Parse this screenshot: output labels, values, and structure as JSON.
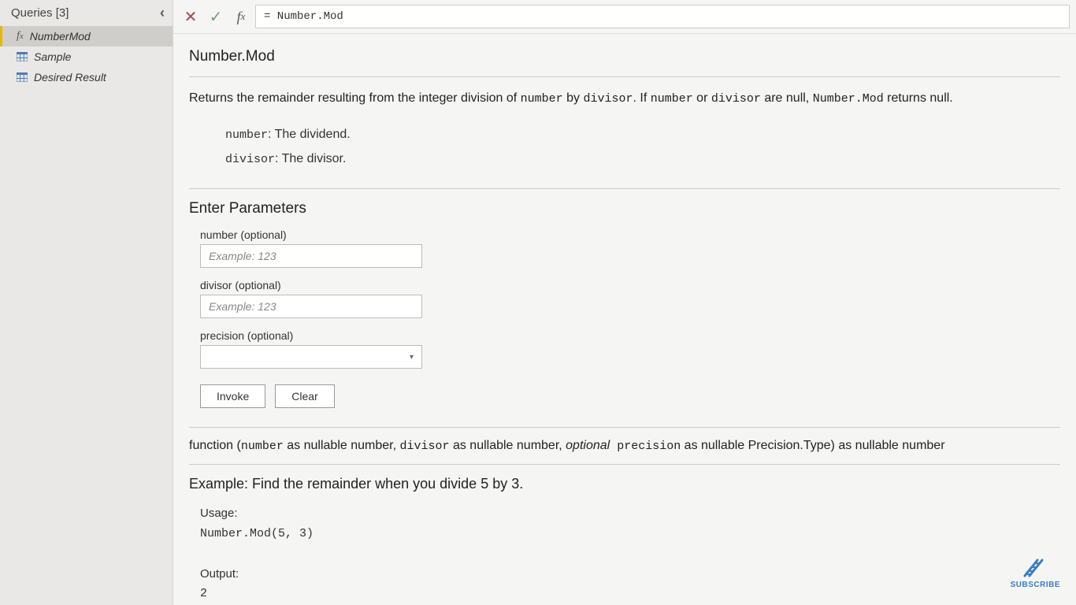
{
  "sidebar": {
    "title": "Queries [3]",
    "items": [
      {
        "label": "NumberMod",
        "icon": "fx"
      },
      {
        "label": "Sample",
        "icon": "table"
      },
      {
        "label": "Desired Result",
        "icon": "table"
      }
    ]
  },
  "formulaBar": {
    "value": "= Number.Mod"
  },
  "doc": {
    "title": "Number.Mod",
    "desc_parts": {
      "pre": "Returns the remainder resulting from the integer division of ",
      "p1": "number",
      "mid1": " by ",
      "p2": "divisor",
      "mid2": ". If ",
      "p3": "number",
      "mid3": " or ",
      "p4": "divisor",
      "mid4": " are null, ",
      "p5": "Number.Mod",
      "post": " returns null."
    },
    "params": [
      {
        "name": "number",
        "text": ": The dividend."
      },
      {
        "name": "divisor",
        "text": ": The divisor."
      }
    ],
    "enter_title": "Enter Parameters",
    "inputs": {
      "number": {
        "label": "number (optional)",
        "placeholder": "Example: 123"
      },
      "divisor": {
        "label": "divisor (optional)",
        "placeholder": "Example: 123"
      },
      "precision": {
        "label": "precision (optional)"
      }
    },
    "buttons": {
      "invoke": "Invoke",
      "clear": "Clear"
    },
    "signature": {
      "pre": "function (",
      "p1": "number",
      "t1": " as nullable number, ",
      "p2": "divisor",
      "t2": " as nullable number, ",
      "opt": "optional",
      "p3": " precision",
      "t3": " as nullable Precision.Type) as nullable number"
    },
    "example": {
      "title": "Example: Find the remainder when you divide 5 by 3.",
      "usage_label": "Usage:",
      "usage_code": "Number.Mod(5, 3)",
      "output_label": "Output:",
      "output_value": "2"
    }
  },
  "subscribe": {
    "label": "SUBSCRIBE"
  }
}
